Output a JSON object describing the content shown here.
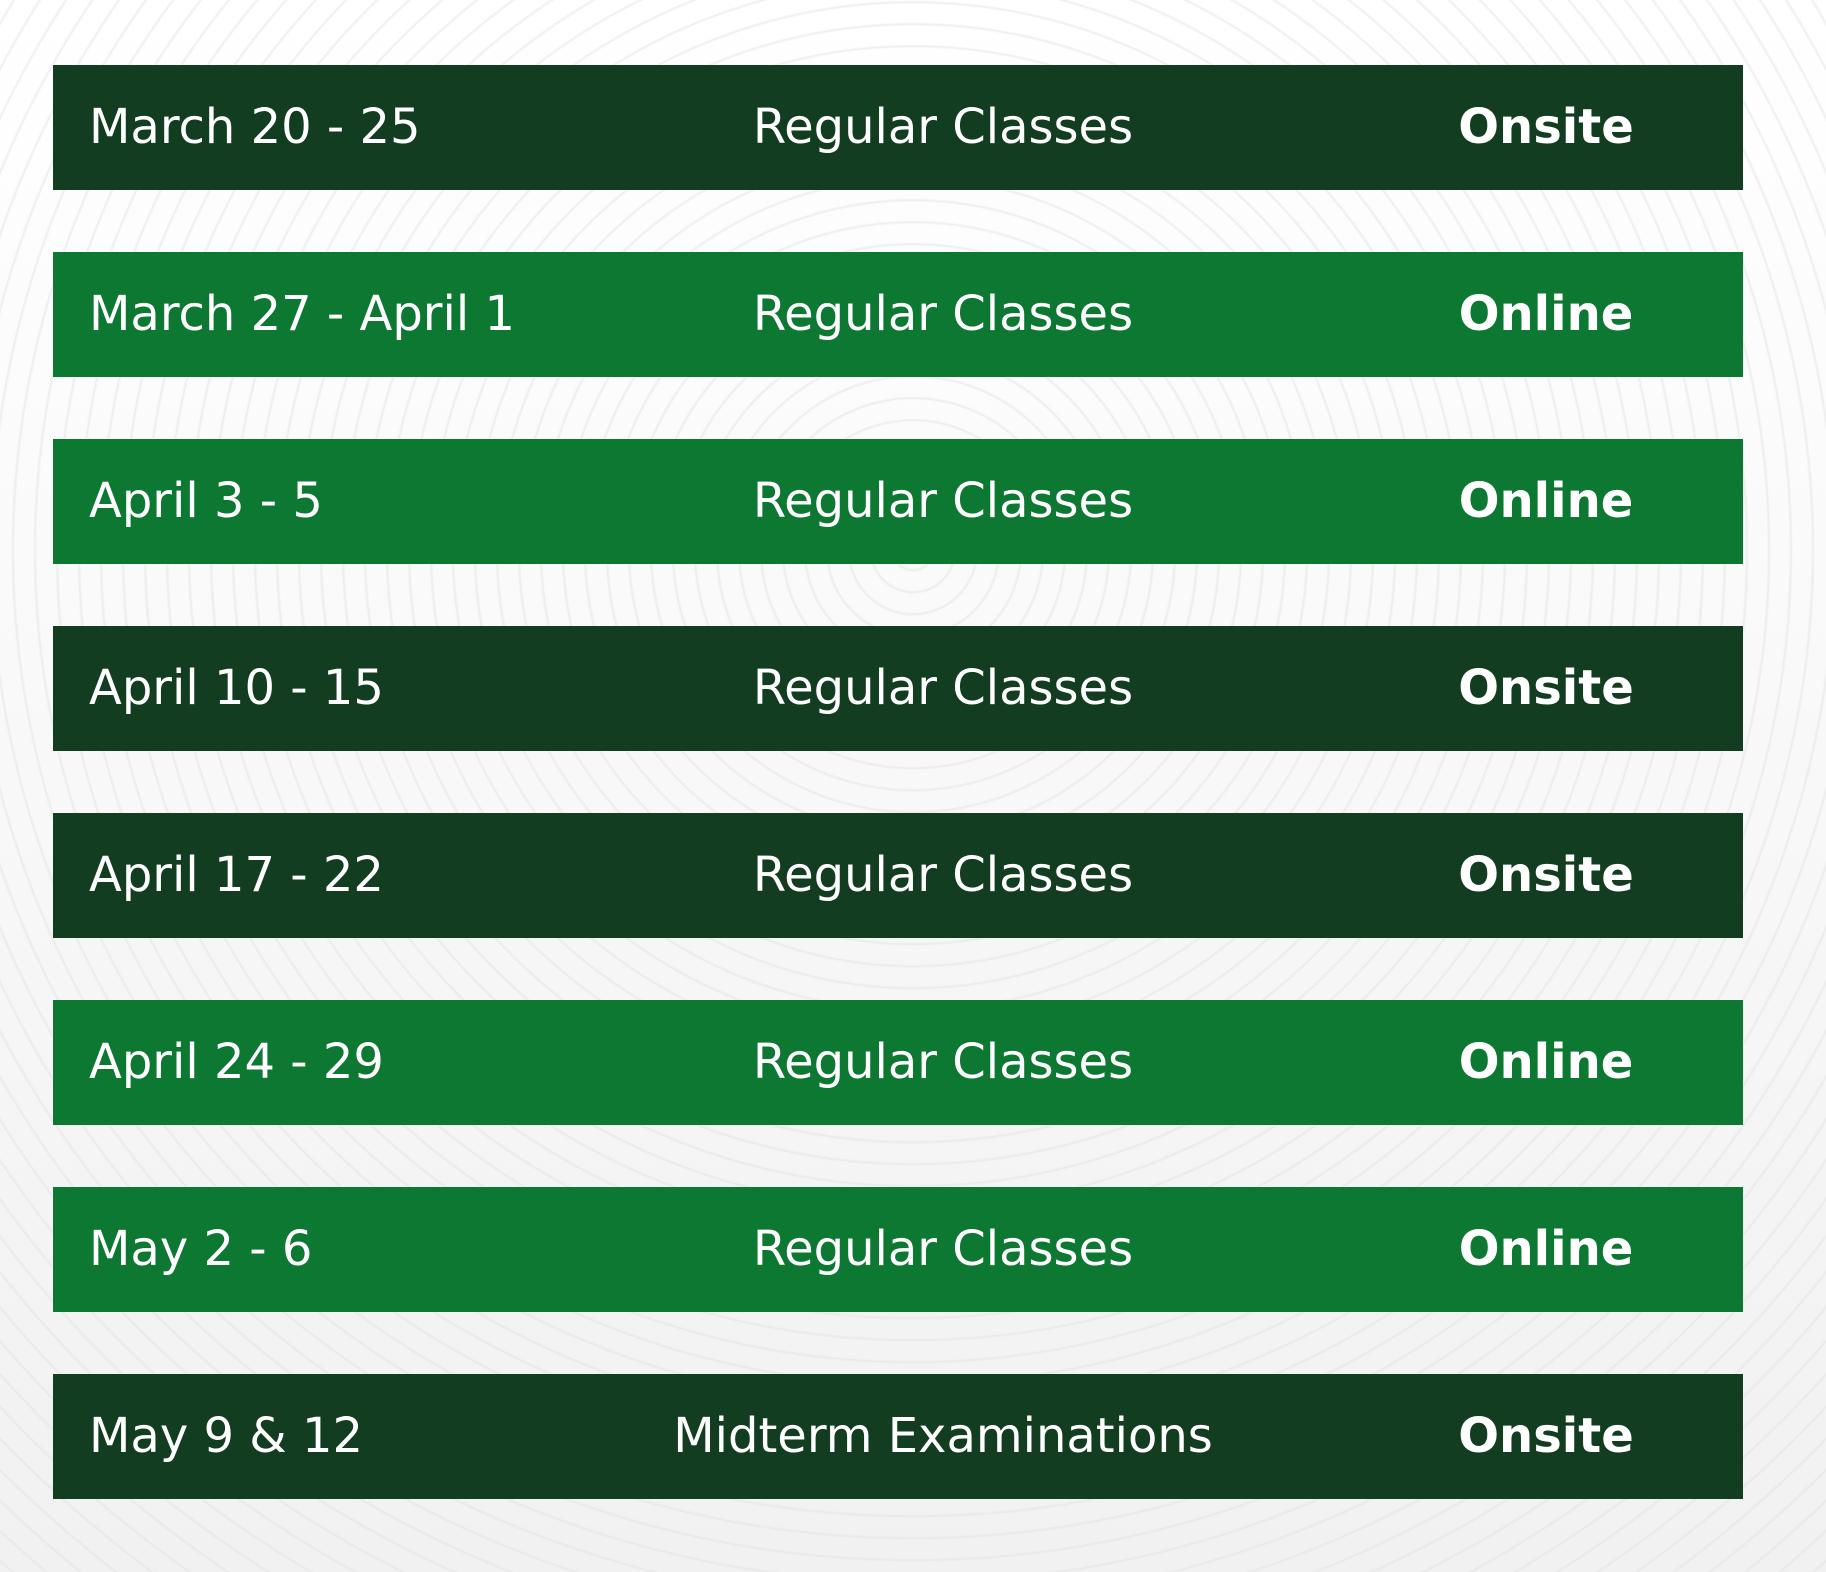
{
  "colors": {
    "onsite_row": "#123d20",
    "online_row": "#0c7832",
    "text": "#ffffff"
  },
  "schedule": {
    "rows": [
      {
        "date": "March 20 - 25",
        "activity": "Regular Classes",
        "mode": "Onsite"
      },
      {
        "date": "March 27 - April 1",
        "activity": "Regular Classes",
        "mode": "Online"
      },
      {
        "date": "April 3 - 5",
        "activity": "Regular Classes",
        "mode": "Online"
      },
      {
        "date": "April 10 - 15",
        "activity": "Regular Classes",
        "mode": "Onsite"
      },
      {
        "date": "April 17 - 22",
        "activity": "Regular Classes",
        "mode": "Onsite"
      },
      {
        "date": "April 24 - 29",
        "activity": "Regular Classes",
        "mode": "Online"
      },
      {
        "date": "May 2 - 6",
        "activity": "Regular Classes",
        "mode": "Online"
      },
      {
        "date": "May 9 & 12",
        "activity": "Midterm Examinations",
        "mode": "Onsite"
      }
    ]
  }
}
